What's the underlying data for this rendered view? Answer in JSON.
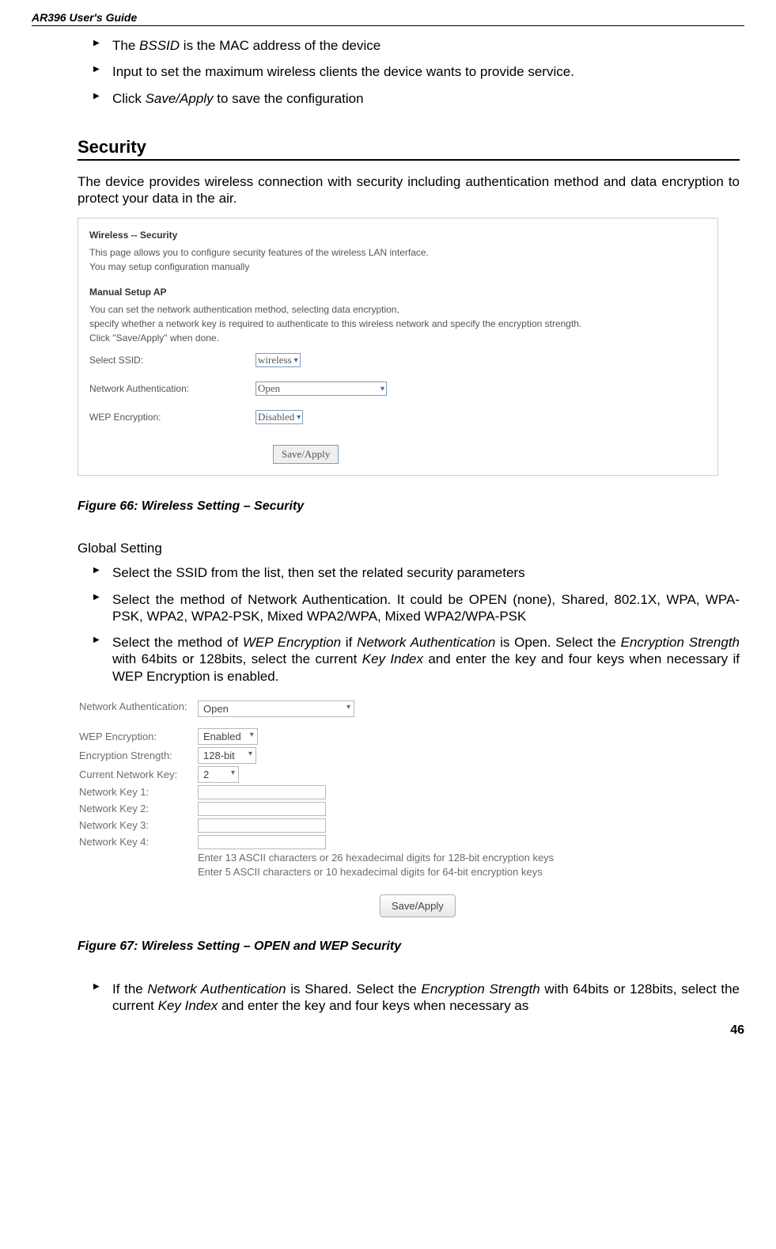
{
  "header": "AR396 User's Guide",
  "page_number": "46",
  "top_bullets": [
    {
      "pre": "The ",
      "em": "BSSID",
      "post": " is the MAC address of the device"
    },
    {
      "pre": "Input to set the maximum wireless clients the device wants to provide service.",
      "em": "",
      "post": ""
    },
    {
      "pre": "Click ",
      "em": "Save/Apply",
      "post": " to save the configuration"
    }
  ],
  "section_title": "Security",
  "section_intro": "The device provides wireless connection with security including authentication method and data encryption to protect your data in the air.",
  "panel1": {
    "title": "Wireless -- Security",
    "desc1": "This page allows you to configure security features of the wireless LAN interface.",
    "desc2": "You may setup configuration manually",
    "sec_title": "Manual Setup AP",
    "sec_desc1": "You can set the network authentication method, selecting data encryption,",
    "sec_desc2": "specify whether a network key is required to authenticate to this wireless network and specify the encryption strength.",
    "sec_desc3": "Click \"Save/Apply\" when done.",
    "row1_label": "Select SSID:",
    "row1_value": "wireless",
    "row2_label": "Network Authentication:",
    "row2_value": "Open",
    "row3_label": "WEP Encryption:",
    "row3_value": "Disabled",
    "button": "Save/Apply"
  },
  "figure66": "Figure 66: Wireless Setting – Security",
  "global_heading": "Global Setting",
  "global_bullets": [
    "Select the SSID from the list, then set the related security parameters",
    "Select the method of Network Authentication. It could be OPEN (none), Shared, 802.1X, WPA, WPA-PSK, WPA2, WPA2-PSK, Mixed WPA2/WPA, Mixed WPA2/WPA-PSK"
  ],
  "global_bullet3": {
    "a": "Select the method of ",
    "b": "WEP Encryption",
    "c": " if ",
    "d": "Network Authentication",
    "e": " is Open. Select the ",
    "f": "Encryption Strength",
    "g": " with 64bits or 128bits, select the current ",
    "h": "Key Index",
    "i": " and enter the key and four keys when necessary if WEP Encryption is enabled."
  },
  "panel2": {
    "rows": [
      {
        "label": "Network Authentication:",
        "type": "select-wide",
        "value": "Open"
      },
      {
        "label": "WEP Encryption:",
        "type": "select",
        "value": "Enabled"
      },
      {
        "label": "Encryption Strength:",
        "type": "select",
        "value": "128-bit"
      },
      {
        "label": "Current Network Key:",
        "type": "select-narrow",
        "value": "2"
      },
      {
        "label": "Network Key 1:",
        "type": "input",
        "value": ""
      },
      {
        "label": "Network Key 2:",
        "type": "input",
        "value": ""
      },
      {
        "label": "Network Key 3:",
        "type": "input",
        "value": ""
      },
      {
        "label": "Network Key 4:",
        "type": "input",
        "value": ""
      }
    ],
    "hint1": "Enter 13 ASCII characters or 26 hexadecimal digits for 128-bit encryption keys",
    "hint2": "Enter 5 ASCII characters or 10 hexadecimal digits for 64-bit encryption keys",
    "button": "Save/Apply"
  },
  "figure67": "Figure 67: Wireless Setting – OPEN and WEP Security",
  "last_bullet": {
    "a": "If the ",
    "b": "Network Authentication",
    "c": " is Shared. Select the ",
    "d": "Encryption Strength",
    "e": " with 64bits or 128bits, select the current ",
    "f": "Key Index",
    "g": " and enter the key and four keys when necessary as"
  }
}
